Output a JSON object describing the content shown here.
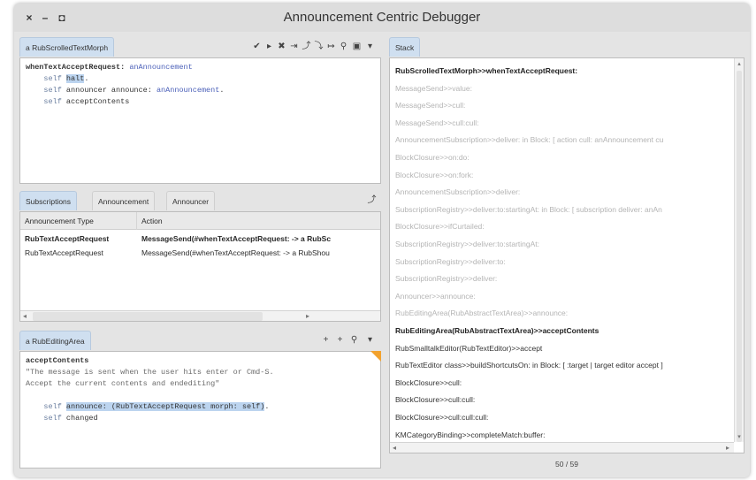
{
  "window": {
    "title": "Announcement Centric Debugger",
    "controls": {
      "close": "×",
      "minimize": "–",
      "maximize": "◘"
    }
  },
  "code_pane": {
    "tab_label": "a RubScrolledTextMorph",
    "toolbar_icons": [
      "check-icon",
      "play-icon",
      "stop-icon",
      "step-over-icon",
      "step-into-icon",
      "step-through-icon",
      "run-to-icon",
      "search-icon",
      "doc-icon",
      "menu-icon"
    ],
    "toolbar_glyphs": [
      "✔",
      "▸",
      "✖",
      "⇥",
      "⤴",
      "⤵",
      "↦",
      "⚲",
      "▣",
      "▾"
    ],
    "selector": "whenTextAcceptRequest:",
    "selector_arg": "anAnnouncement",
    "line1_kw": "self",
    "line1_msg": "halt",
    "line1_dot": ".",
    "line2_kw": "self",
    "line2_msg": "announcer announce: ",
    "line2_arg": "anAnnouncement",
    "line2_dot": ".",
    "line3_kw": "self",
    "line3_msg": "acceptContents"
  },
  "subscriptions_pane": {
    "tabs": [
      "Subscriptions",
      "Announcement",
      "Announcer"
    ],
    "active_tab": "Subscriptions",
    "action_icon": "⤴",
    "columns": [
      "Announcement Type",
      "Action"
    ],
    "rows": [
      {
        "type": "RubTextAcceptRequest",
        "action": "MessageSend(#whenTextAcceptRequest: -> a RubSc",
        "bold": true
      },
      {
        "type": "RubTextAcceptRequest",
        "action": "MessageSend(#whenTextAcceptRequest: -> a RubShou",
        "bold": false
      }
    ],
    "scroll_left": "◂",
    "scroll_right": "▸"
  },
  "editing_pane": {
    "tab_label": "a RubEditingArea",
    "toolbar_glyphs": [
      "+",
      "+",
      "⚲",
      "▾"
    ],
    "selector": "acceptContents",
    "comment_line1": "\"The message is sent when the user hits enter or Cmd-S.",
    "comment_line2": "Accept the current contents and endediting\"",
    "line1_kw": "self",
    "line1_sel": "announce: (RubTextAcceptRequest morph: self)",
    "line1_dot": ".",
    "line2_kw": "self",
    "line2_msg": "changed"
  },
  "stack_pane": {
    "tab_label": "Stack",
    "frames": [
      {
        "text": "RubScrolledTextMorph>>whenTextAcceptRequest:",
        "style": "bold"
      },
      {
        "text": "MessageSend>>value:",
        "style": "dim"
      },
      {
        "text": "MessageSend>>cull:",
        "style": "dim"
      },
      {
        "text": "MessageSend>>cull:cull:",
        "style": "dim"
      },
      {
        "text": "AnnouncementSubscription>>deliver: in Block: [ action cull: anAnnouncement cu",
        "style": "dim"
      },
      {
        "text": "BlockClosure>>on:do:",
        "style": "dim"
      },
      {
        "text": "BlockClosure>>on:fork:",
        "style": "dim"
      },
      {
        "text": "AnnouncementSubscription>>deliver:",
        "style": "dim"
      },
      {
        "text": "SubscriptionRegistry>>deliver:to:startingAt: in Block: [ subscription deliver: anAn",
        "style": "dim"
      },
      {
        "text": "BlockClosure>>ifCurtailed:",
        "style": "dim"
      },
      {
        "text": "SubscriptionRegistry>>deliver:to:startingAt:",
        "style": "dim"
      },
      {
        "text": "SubscriptionRegistry>>deliver:to:",
        "style": "dim"
      },
      {
        "text": "SubscriptionRegistry>>deliver:",
        "style": "dim"
      },
      {
        "text": "Announcer>>announce:",
        "style": "dim"
      },
      {
        "text": "RubEditingArea(RubAbstractTextArea)>>announce:",
        "style": "dim"
      },
      {
        "text": "RubEditingArea(RubAbstractTextArea)>>acceptContents",
        "style": "bold"
      },
      {
        "text": "RubSmalltalkEditor(RubTextEditor)>>accept",
        "style": "normal"
      },
      {
        "text": "RubTextEditor class>>buildShortcutsOn: in Block: [ :target | target editor accept ]",
        "style": "normal"
      },
      {
        "text": "BlockClosure>>cull:",
        "style": "normal"
      },
      {
        "text": "BlockClosure>>cull:cull:",
        "style": "normal"
      },
      {
        "text": "BlockClosure>>cull:cull:cull:",
        "style": "normal"
      },
      {
        "text": "KMCategoryBinding>>completeMatch:buffer:",
        "style": "normal"
      }
    ],
    "counter": "50 / 59",
    "scroll_up": "▴",
    "scroll_down": "▾",
    "scroll_left": "◂",
    "scroll_right": "▸"
  }
}
